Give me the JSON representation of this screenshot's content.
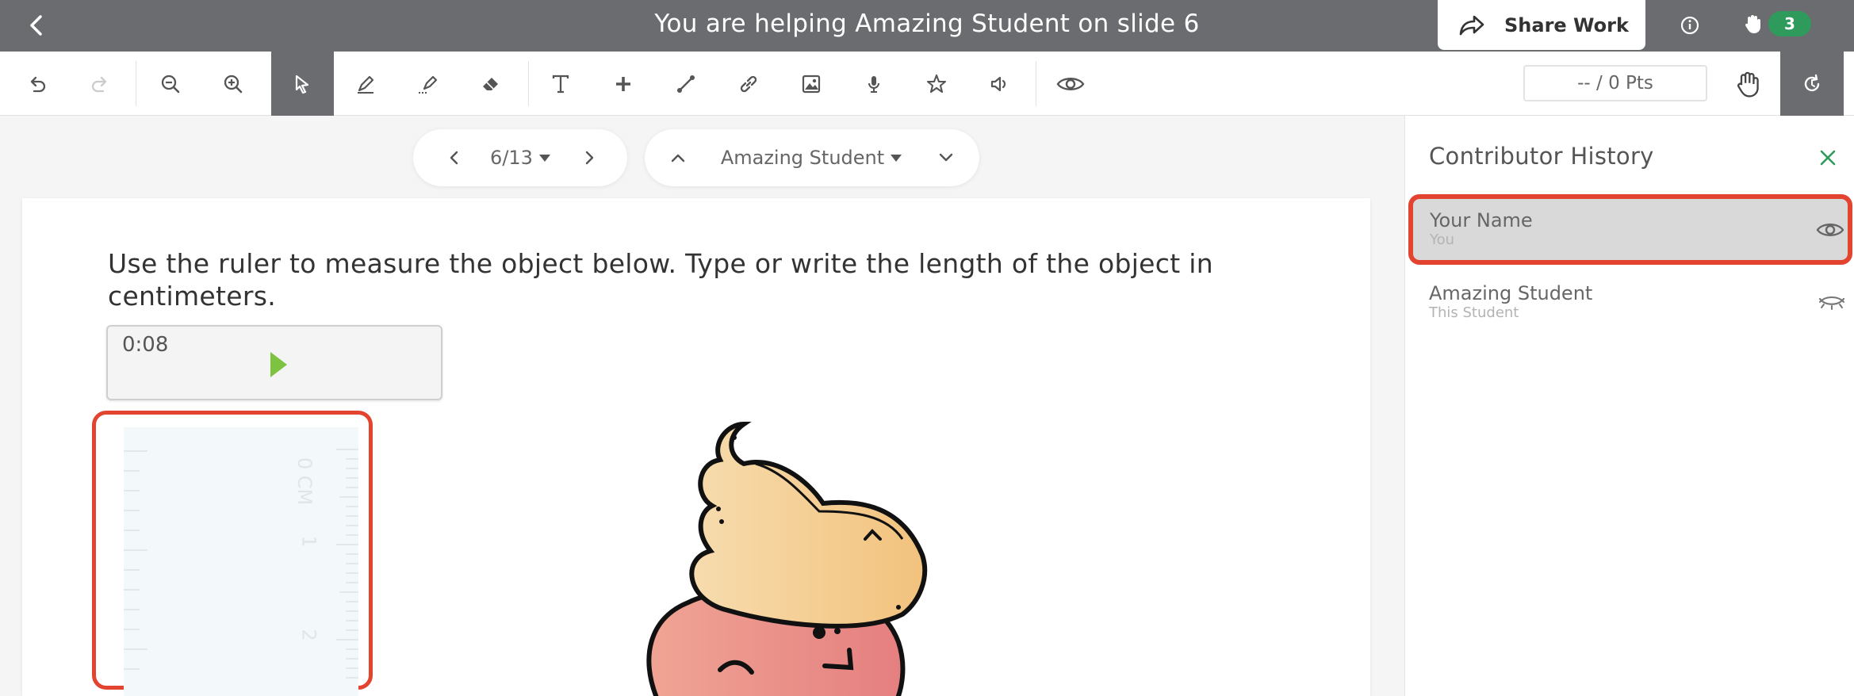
{
  "header": {
    "title": "You are helping Amazing Student on slide 6",
    "share_label": "Share Work",
    "hand_count": "3"
  },
  "toolbar": {
    "points": "-- / 0 Pts",
    "tools": [
      "undo-icon",
      "redo-icon",
      "zoom-out-icon",
      "zoom-in-icon",
      "select-icon",
      "pen-icon",
      "highlighter-icon",
      "eraser-icon",
      "text-icon",
      "add-icon",
      "line-icon",
      "link-icon",
      "image-icon",
      "microphone-icon",
      "star-icon",
      "speaker-icon",
      "eye-icon"
    ],
    "active_tool": "select-icon"
  },
  "navigation": {
    "slide_position": "6/13",
    "student_name": "Amazing Student"
  },
  "slide": {
    "question": "Use the ruler to measure the object below. Type or write the length of the object in centimeters.",
    "audio_time": "0:08",
    "ruler_labels": [
      "0 CM",
      "1",
      "2"
    ]
  },
  "panel": {
    "title": "Contributor History",
    "contributors": [
      {
        "name": "Your Name",
        "sub": "You",
        "visible": true
      },
      {
        "name": "Amazing Student",
        "sub": "This Student",
        "visible": false
      }
    ]
  },
  "colors": {
    "topbar": "#6b6c6f",
    "highlight": "#e2442f",
    "badge_green": "#2e9a5b",
    "close_green": "#2e9a5b",
    "play_green": "#7ec242"
  }
}
